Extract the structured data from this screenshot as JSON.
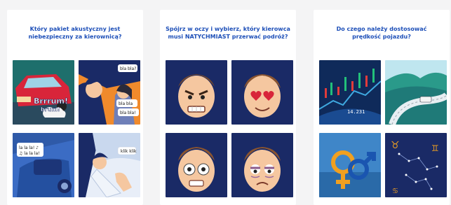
{
  "quiz": {
    "cards": [
      {
        "question": "Który pakiet akustyczny jest\nniebezpieczny za kierownicą?",
        "answers": [
          {
            "icon": "honking-car-icon",
            "text1": "Brrrum!",
            "text2": "brum!"
          },
          {
            "icon": "chatting-passengers-icon",
            "text1": "bla bla?",
            "text2": "bla bla",
            "text3": "bla bla!"
          },
          {
            "icon": "singing-driver-icon",
            "text1": "la la la! ♪",
            "text2": "♫ la la la!"
          },
          {
            "icon": "clicking-fingers-icon",
            "text1": "klik klik"
          }
        ]
      },
      {
        "question": "Spójrz w oczy i wybierz, który kierowca\nmusi NATYCHMIAST przerwać podróż?",
        "answers": [
          {
            "icon": "angry-face-icon"
          },
          {
            "icon": "heart-eyes-face-icon"
          },
          {
            "icon": "wide-eyed-face-icon"
          },
          {
            "icon": "tired-face-icon"
          }
        ]
      },
      {
        "question": "Do czego należy dostosować\nprędkość pojazdu?",
        "answers": [
          {
            "icon": "stock-chart-icon",
            "text1": "14.231"
          },
          {
            "icon": "winding-road-icon"
          },
          {
            "icon": "gender-symbols-icon"
          },
          {
            "icon": "zodiac-constellation-icon"
          }
        ]
      }
    ]
  },
  "colors": {
    "question_text": "#1d4fb8",
    "card_bg": "#ffffff",
    "page_bg": "#f4f4f5",
    "navy": "#1a2a66",
    "teal": "#1f7a78",
    "orange": "#f08a2c",
    "red": "#d8253a"
  }
}
